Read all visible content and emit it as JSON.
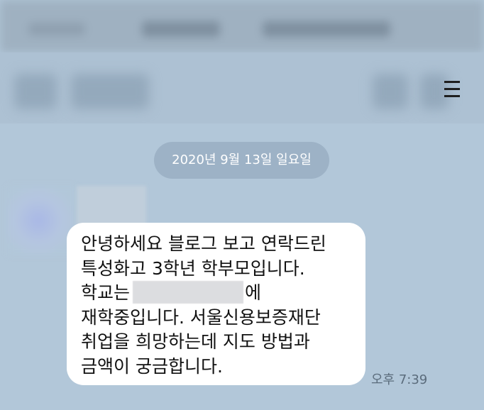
{
  "date_separator": "2020년 9월 13일 일요일",
  "message": {
    "lines": [
      "안녕하세요 블로그 보고 연락드린",
      "특성화고 3학년 학부모입니다.",
      "학교는",
      "에",
      "재학중입니다. 서울신용보증재단",
      "취업을 희망하는데 지도 방법과",
      "금액이 궁금합니다."
    ],
    "time": "오후 7:39"
  },
  "icons": {
    "menu": "hamburger-menu-icon"
  },
  "colors": {
    "background": "#b2c7d9",
    "bubble": "#ffffff",
    "date_pill": "#9db2c6"
  }
}
